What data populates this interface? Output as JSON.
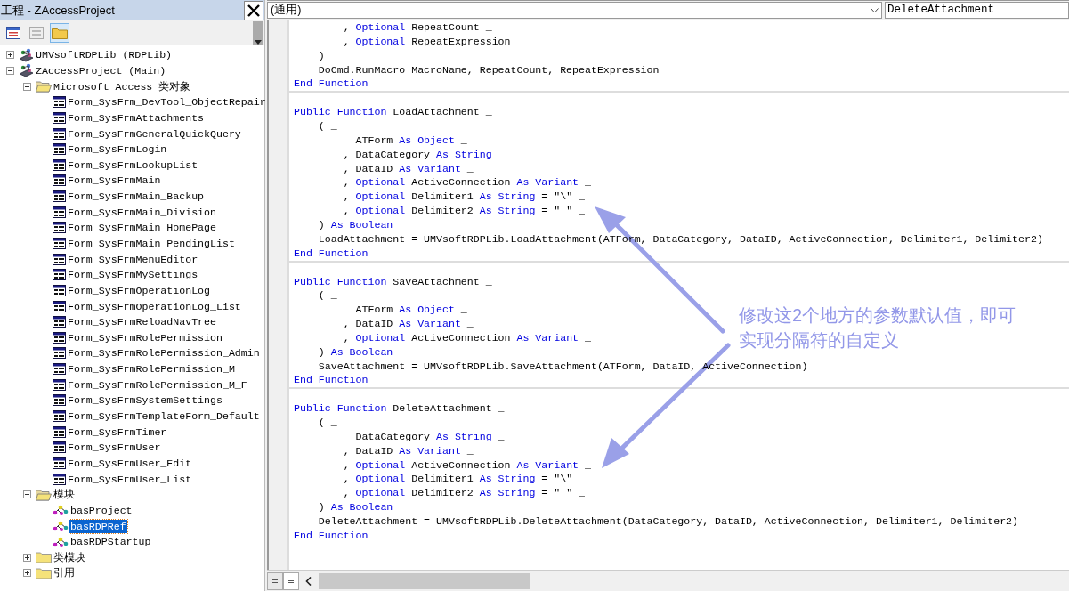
{
  "project_pane": {
    "title": "工程 - ZAccessProject",
    "toolbar": [
      {
        "kind": "view-code",
        "selected": false
      },
      {
        "kind": "view-object",
        "selected": false
      },
      {
        "kind": "toggle-folders",
        "selected": true
      }
    ],
    "tree": [
      {
        "label": "UMVsoftRDPLib (RDPLib)",
        "kind": "project",
        "expanded": false,
        "selected": false
      },
      {
        "label": "ZAccessProject (Main)",
        "kind": "project",
        "expanded": true,
        "selected": false,
        "children": [
          {
            "label": "Microsoft Access 类对象",
            "kind": "folder",
            "expanded": true,
            "selected": false,
            "children": [
              {
                "label": "Form_SysFrm_DevTool_ObjectRepair",
                "kind": "form",
                "selected": false
              },
              {
                "label": "Form_SysFrmAttachments",
                "kind": "form",
                "selected": false
              },
              {
                "label": "Form_SysFrmGeneralQuickQuery",
                "kind": "form",
                "selected": false
              },
              {
                "label": "Form_SysFrmLogin",
                "kind": "form",
                "selected": false
              },
              {
                "label": "Form_SysFrmLookupList",
                "kind": "form",
                "selected": false
              },
              {
                "label": "Form_SysFrmMain",
                "kind": "form",
                "selected": false
              },
              {
                "label": "Form_SysFrmMain_Backup",
                "kind": "form",
                "selected": false
              },
              {
                "label": "Form_SysFrmMain_Division",
                "kind": "form",
                "selected": false
              },
              {
                "label": "Form_SysFrmMain_HomePage",
                "kind": "form",
                "selected": false
              },
              {
                "label": "Form_SysFrmMain_PendingList",
                "kind": "form",
                "selected": false
              },
              {
                "label": "Form_SysFrmMenuEditor",
                "kind": "form",
                "selected": false
              },
              {
                "label": "Form_SysFrmMySettings",
                "kind": "form",
                "selected": false
              },
              {
                "label": "Form_SysFrmOperationLog",
                "kind": "form",
                "selected": false
              },
              {
                "label": "Form_SysFrmOperationLog_List",
                "kind": "form",
                "selected": false
              },
              {
                "label": "Form_SysFrmReloadNavTree",
                "kind": "form",
                "selected": false
              },
              {
                "label": "Form_SysFrmRolePermission",
                "kind": "form",
                "selected": false
              },
              {
                "label": "Form_SysFrmRolePermission_Admin",
                "kind": "form",
                "selected": false
              },
              {
                "label": "Form_SysFrmRolePermission_M",
                "kind": "form",
                "selected": false
              },
              {
                "label": "Form_SysFrmRolePermission_M_F",
                "kind": "form",
                "selected": false
              },
              {
                "label": "Form_SysFrmSystemSettings",
                "kind": "form",
                "selected": false
              },
              {
                "label": "Form_SysFrmTemplateForm_Default",
                "kind": "form",
                "selected": false
              },
              {
                "label": "Form_SysFrmTimer",
                "kind": "form",
                "selected": false
              },
              {
                "label": "Form_SysFrmUser",
                "kind": "form",
                "selected": false
              },
              {
                "label": "Form_SysFrmUser_Edit",
                "kind": "form",
                "selected": false
              },
              {
                "label": "Form_SysFrmUser_List",
                "kind": "form",
                "selected": false
              }
            ]
          },
          {
            "label": "模块",
            "kind": "folder",
            "expanded": true,
            "selected": false,
            "children": [
              {
                "label": "basProject",
                "kind": "module",
                "selected": false
              },
              {
                "label": "basRDPRef",
                "kind": "module",
                "selected": true
              },
              {
                "label": "basRDPStartup",
                "kind": "module",
                "selected": false
              }
            ]
          },
          {
            "label": "类模块",
            "kind": "folder",
            "expanded": false,
            "selected": false
          },
          {
            "label": "引用",
            "kind": "folder",
            "expanded": false,
            "selected": false
          }
        ]
      }
    ]
  },
  "code_pane": {
    "object_combo": "(通用)",
    "procedure_combo": "DeleteAttachment",
    "procedures": [
      {
        "lines": [
          [
            {
              "text": "        , ",
              "kind": "plain"
            },
            {
              "text": "Optional",
              "kind": "keyword"
            },
            {
              "text": " RepeatCount _",
              "kind": "plain"
            }
          ],
          [
            {
              "text": "        , ",
              "kind": "plain"
            },
            {
              "text": "Optional",
              "kind": "keyword"
            },
            {
              "text": " RepeatExpression _",
              "kind": "plain"
            }
          ],
          [
            {
              "text": "    )",
              "kind": "plain"
            }
          ],
          [
            {
              "text": "    DoCmd.RunMacro MacroName, RepeatCount, RepeatExpression",
              "kind": "plain"
            }
          ],
          [
            {
              "text": "End Function",
              "kind": "keyword"
            }
          ]
        ]
      },
      {
        "lines": [
          [
            {
              "text": "Public Function",
              "kind": "keyword"
            },
            {
              "text": " LoadAttachment _",
              "kind": "plain"
            }
          ],
          [
            {
              "text": "    ( _",
              "kind": "plain"
            }
          ],
          [
            {
              "text": "          ATForm ",
              "kind": "plain"
            },
            {
              "text": "As Object",
              "kind": "keyword"
            },
            {
              "text": " _",
              "kind": "plain"
            }
          ],
          [
            {
              "text": "        , DataCategory ",
              "kind": "plain"
            },
            {
              "text": "As String",
              "kind": "keyword"
            },
            {
              "text": " _",
              "kind": "plain"
            }
          ],
          [
            {
              "text": "        , DataID ",
              "kind": "plain"
            },
            {
              "text": "As Variant",
              "kind": "keyword"
            },
            {
              "text": " _",
              "kind": "plain"
            }
          ],
          [
            {
              "text": "        , ",
              "kind": "plain"
            },
            {
              "text": "Optional",
              "kind": "keyword"
            },
            {
              "text": " ActiveConnection ",
              "kind": "plain"
            },
            {
              "text": "As Variant",
              "kind": "keyword"
            },
            {
              "text": " _",
              "kind": "plain"
            }
          ],
          [
            {
              "text": "        , ",
              "kind": "plain"
            },
            {
              "text": "Optional",
              "kind": "keyword"
            },
            {
              "text": " Delimiter1 ",
              "kind": "plain"
            },
            {
              "text": "As String",
              "kind": "keyword"
            },
            {
              "text": " = \"\\\" _",
              "kind": "plain"
            }
          ],
          [
            {
              "text": "        , ",
              "kind": "plain"
            },
            {
              "text": "Optional",
              "kind": "keyword"
            },
            {
              "text": " Delimiter2 ",
              "kind": "plain"
            },
            {
              "text": "As String",
              "kind": "keyword"
            },
            {
              "text": " = \" \" _",
              "kind": "plain"
            }
          ],
          [
            {
              "text": "    ) ",
              "kind": "plain"
            },
            {
              "text": "As Boolean",
              "kind": "keyword"
            }
          ],
          [
            {
              "text": "    LoadAttachment = UMVsoftRDPLib.LoadAttachment(ATForm, DataCategory, DataID, ActiveConnection, Delimiter1, Delimiter2)",
              "kind": "plain"
            }
          ],
          [
            {
              "text": "End Function",
              "kind": "keyword"
            }
          ]
        ]
      },
      {
        "lines": [
          [
            {
              "text": "Public Function",
              "kind": "keyword"
            },
            {
              "text": " SaveAttachment _",
              "kind": "plain"
            }
          ],
          [
            {
              "text": "    ( _",
              "kind": "plain"
            }
          ],
          [
            {
              "text": "          ATForm ",
              "kind": "plain"
            },
            {
              "text": "As Object",
              "kind": "keyword"
            },
            {
              "text": " _",
              "kind": "plain"
            }
          ],
          [
            {
              "text": "        , DataID ",
              "kind": "plain"
            },
            {
              "text": "As Variant",
              "kind": "keyword"
            },
            {
              "text": " _",
              "kind": "plain"
            }
          ],
          [
            {
              "text": "        , ",
              "kind": "plain"
            },
            {
              "text": "Optional",
              "kind": "keyword"
            },
            {
              "text": " ActiveConnection ",
              "kind": "plain"
            },
            {
              "text": "As Variant",
              "kind": "keyword"
            },
            {
              "text": " _",
              "kind": "plain"
            }
          ],
          [
            {
              "text": "    ) ",
              "kind": "plain"
            },
            {
              "text": "As Boolean",
              "kind": "keyword"
            }
          ],
          [
            {
              "text": "    SaveAttachment = UMVsoftRDPLib.SaveAttachment(ATForm, DataID, ActiveConnection)",
              "kind": "plain"
            }
          ],
          [
            {
              "text": "End Function",
              "kind": "keyword"
            }
          ]
        ]
      },
      {
        "lines": [
          [
            {
              "text": "Public Function",
              "kind": "keyword"
            },
            {
              "text": " DeleteAttachment _",
              "kind": "plain"
            }
          ],
          [
            {
              "text": "    ( _",
              "kind": "plain"
            }
          ],
          [
            {
              "text": "          DataCategory ",
              "kind": "plain"
            },
            {
              "text": "As String",
              "kind": "keyword"
            },
            {
              "text": " _",
              "kind": "plain"
            }
          ],
          [
            {
              "text": "        , DataID ",
              "kind": "plain"
            },
            {
              "text": "As Variant",
              "kind": "keyword"
            },
            {
              "text": " _",
              "kind": "plain"
            }
          ],
          [
            {
              "text": "        , ",
              "kind": "plain"
            },
            {
              "text": "Optional",
              "kind": "keyword"
            },
            {
              "text": " ActiveConnection ",
              "kind": "plain"
            },
            {
              "text": "As Variant",
              "kind": "keyword"
            },
            {
              "text": " _",
              "kind": "plain"
            }
          ],
          [
            {
              "text": "        , ",
              "kind": "plain"
            },
            {
              "text": "Optional",
              "kind": "keyword"
            },
            {
              "text": " Delimiter1 ",
              "kind": "plain"
            },
            {
              "text": "As String",
              "kind": "keyword"
            },
            {
              "text": " = \"\\\" _",
              "kind": "plain"
            }
          ],
          [
            {
              "text": "        , ",
              "kind": "plain"
            },
            {
              "text": "Optional",
              "kind": "keyword"
            },
            {
              "text": " Delimiter2 ",
              "kind": "plain"
            },
            {
              "text": "As String",
              "kind": "keyword"
            },
            {
              "text": " = \" \" _",
              "kind": "plain"
            }
          ],
          [
            {
              "text": "    ) ",
              "kind": "plain"
            },
            {
              "text": "As Boolean",
              "kind": "keyword"
            }
          ],
          [
            {
              "text": "    DeleteAttachment = UMVsoftRDPLib.DeleteAttachment(DataCategory, DataID, ActiveConnection, Delimiter1, Delimiter2)",
              "kind": "plain"
            }
          ],
          [
            {
              "text": "End Function",
              "kind": "keyword"
            }
          ]
        ]
      }
    ]
  },
  "annotation": {
    "lines": [
      "修改这2个地方的参数默认值，即可",
      "实现分隔符的自定义"
    ]
  }
}
